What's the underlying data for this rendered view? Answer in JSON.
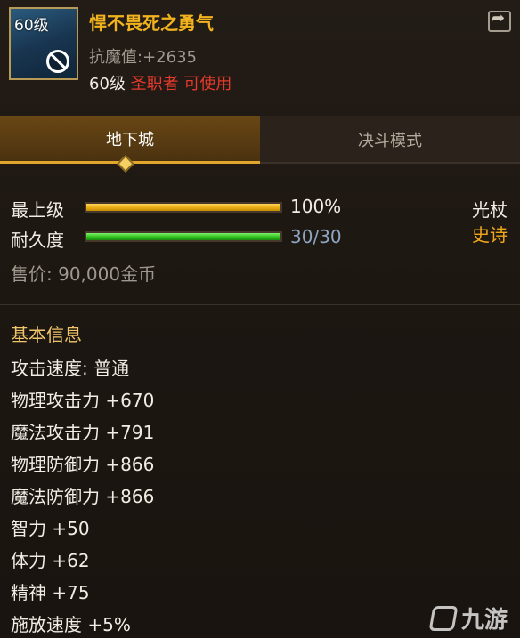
{
  "item": {
    "icon_level": "60级",
    "name": "悍不畏死之勇气",
    "stat_label": "抗魔值:",
    "stat_value": "+2635",
    "req_level": "60级",
    "req_class": "圣职者",
    "req_usable": "可使用"
  },
  "tabs": [
    "地下城",
    "决斗模式"
  ],
  "bars": {
    "quality_label": "最上级",
    "quality_value": "100%",
    "quality_fraction": 1.0,
    "durability_label": "耐久度",
    "durability_value": "30/30",
    "durability_fraction": 1.0
  },
  "weapon": {
    "type": "光杖",
    "rarity": "史诗"
  },
  "price": "售价: 90,000金币",
  "section_title": "基本信息",
  "attributes": [
    "攻击速度: 普通",
    "物理攻击力 +670",
    "魔法攻击力 +791",
    "物理防御力 +866",
    "魔法防御力 +866",
    "智力 +50",
    "体力 +62",
    "精神 +75",
    "施放速度 +5%"
  ],
  "watermark": "九游",
  "colors": {
    "item_name": "#f1b41e",
    "restriction": "#e43a2b",
    "rarity_epic": "#f0a81a",
    "quality_bar": "#e9ad12",
    "durability_bar": "#2fbe1c"
  }
}
